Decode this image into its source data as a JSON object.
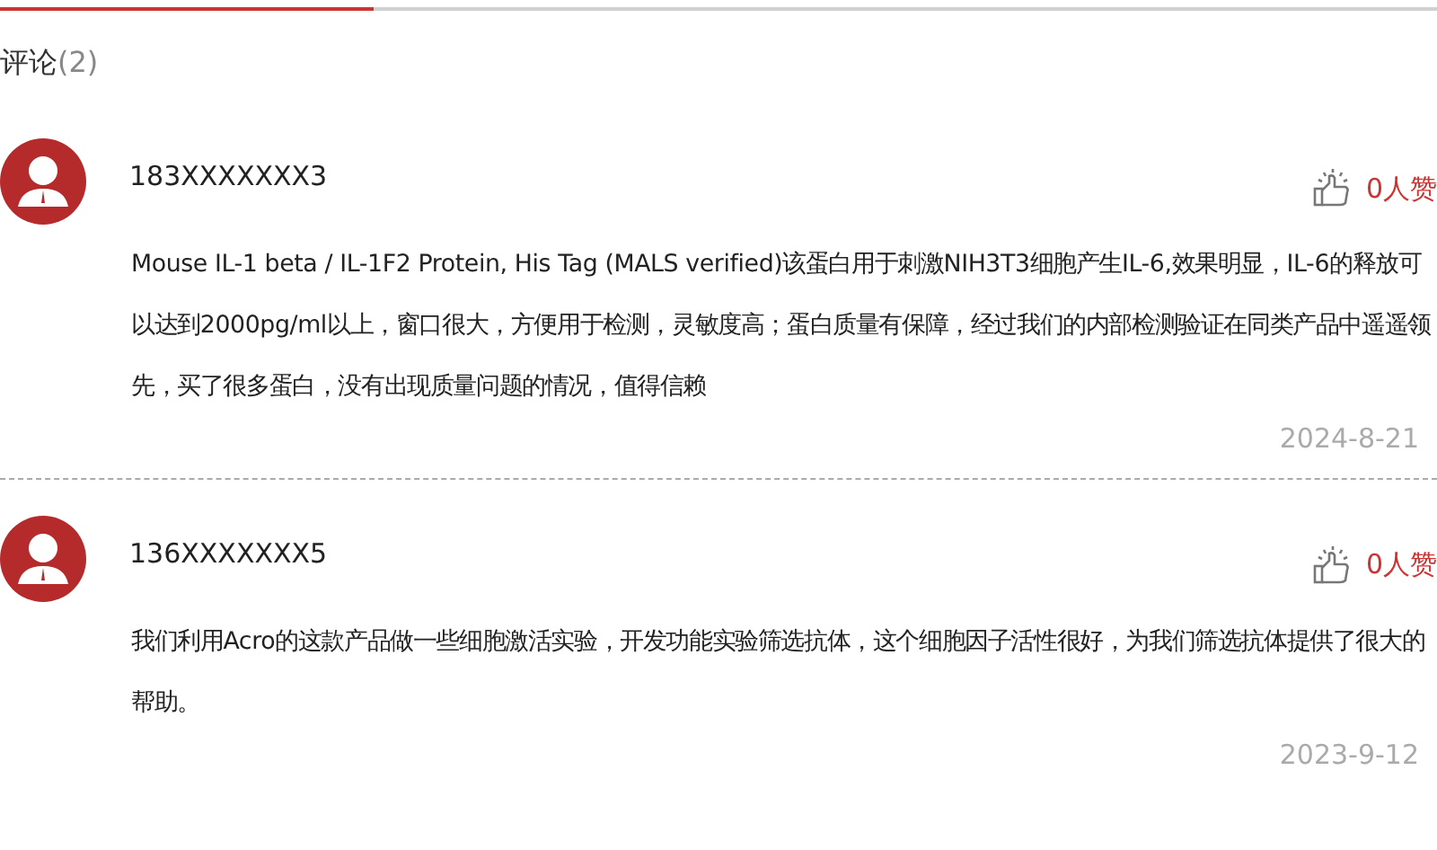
{
  "heading": {
    "title": "评论",
    "count": "(2)"
  },
  "comments": [
    {
      "user": "183XXXXXXX3",
      "likes": "0人赞",
      "text": "Mouse IL-1 beta / IL-1F2 Protein, His Tag (MALS verified)该蛋白用于刺激NIH3T3细胞产生IL-6,效果明显，IL-6的释放可以达到2000pg/ml以上，窗口很大，方便用于检测，灵敏度高；蛋白质量有保障，经过我们的内部检测验证在同类产品中遥遥领先，买了很多蛋白，没有出现质量问题的情况，值得信赖",
      "date": "2024-8-21"
    },
    {
      "user": "136XXXXXXX5",
      "likes": "0人赞",
      "text": "我们利用Acro的这款产品做一些细胞激活实验，开发功能实验筛选抗体，这个细胞因子活性很好，为我们筛选抗体提供了很大的帮助。",
      "date": "2023-9-12"
    }
  ]
}
